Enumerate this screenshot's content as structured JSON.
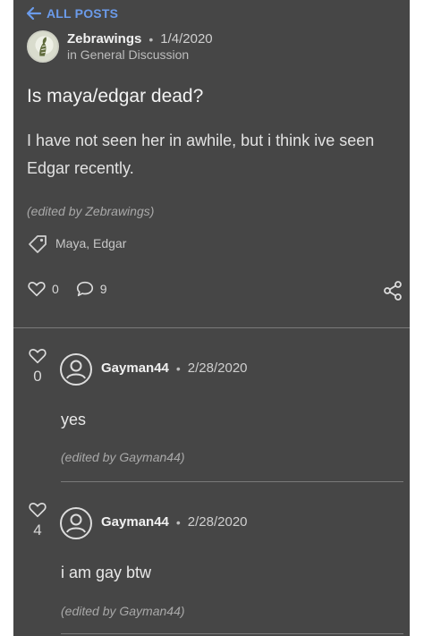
{
  "nav": {
    "back_label": "ALL POSTS"
  },
  "post": {
    "author": "Zebrawings",
    "date": "1/4/2020",
    "category": "in General Discussion",
    "title": "Is maya/edgar dead?",
    "body": "I have not seen her in awhile, but i think ive seen Edgar recently.",
    "edited": "(edited by Zebrawings)",
    "tags": "Maya, Edgar",
    "likes": "0",
    "comments": "9"
  },
  "replies": [
    {
      "likes": "0",
      "author": "Gayman44",
      "date": "2/28/2020",
      "text": "yes",
      "edited": "(edited by Gayman44)"
    },
    {
      "likes": "4",
      "author": "Gayman44",
      "date": "2/28/2020",
      "text": "i am gay btw",
      "edited": "(edited by Gayman44)"
    }
  ],
  "colors": {
    "panel": "#464646",
    "accent": "#6b9bea",
    "page": "#ffffff"
  },
  "icons": [
    "back-arrow-icon",
    "tag-icon",
    "heart-icon",
    "comment-icon",
    "share-icon",
    "user-avatar-icon"
  ]
}
